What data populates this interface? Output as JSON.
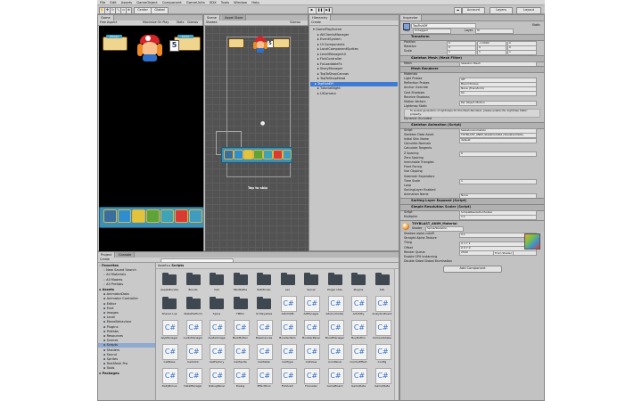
{
  "menubar": {
    "items": [
      "File",
      "Edit",
      "Assets",
      "GameObject",
      "Component",
      "GameUnits",
      "SDX",
      "Tools",
      "Window",
      "Help"
    ]
  },
  "toolbar": {
    "pivot": "Center",
    "space": "Global",
    "account": "Account",
    "layers": "Layers",
    "layout": "Layout"
  },
  "game_view": {
    "tab": "Game",
    "aspect": "Free Aspect",
    "scale_label": "Maximize On Play",
    "stats": "Stats",
    "gizmos": "Gizmos",
    "hud": {
      "left_label": "Moves",
      "right_label": "Score",
      "counter": "5"
    }
  },
  "scene_view": {
    "tabs": [
      "Scene",
      "Asset Store"
    ],
    "mode": "Shaded",
    "gizmos": "Gizmos",
    "tap_label": "Tap to skip",
    "counter": "5"
  },
  "hierarchy": {
    "tab": "Hierarchy",
    "create": "Create",
    "items": [
      {
        "label": "GamePlayScene",
        "selected": false,
        "indent": 0
      },
      {
        "label": "AllClientsManager",
        "selected": false,
        "indent": 1
      },
      {
        "label": "EventSystem",
        "selected": false,
        "indent": 1
      },
      {
        "label": "UI Components",
        "selected": false,
        "indent": 1
      },
      {
        "label": "LocalComponentSprites",
        "selected": false,
        "indent": 1
      },
      {
        "label": "LevelManagerUI",
        "selected": false,
        "indent": 1
      },
      {
        "label": "FishController",
        "selected": false,
        "indent": 1
      },
      {
        "label": "FxLoadableFx",
        "selected": false,
        "indent": 1
      },
      {
        "label": "StoryManager",
        "selected": false,
        "indent": 1
      },
      {
        "label": "TopToShopCanvas",
        "selected": false,
        "indent": 1
      },
      {
        "label": "TapToShopHead",
        "selected": false,
        "indent": 1
      },
      {
        "label": "TapFishEff",
        "selected": true,
        "indent": 1
      },
      {
        "label": "TutorialNight",
        "selected": false,
        "indent": 1
      },
      {
        "label": "UICamera",
        "selected": false,
        "indent": 1
      }
    ]
  },
  "inspector": {
    "tab": "Inspector",
    "object_name": "TapFishEff",
    "static": "Static",
    "tag_label": "Tag",
    "tag": "Untagged",
    "layer_label": "Layer",
    "layer": "UI",
    "transform": {
      "title": "Transform",
      "position": "Position",
      "rotation": "Rotation",
      "scale": "Scale",
      "px": "0",
      "py": "-1.0000",
      "pz": "0",
      "rx": "0",
      "ry": "0",
      "rz": "0",
      "sx": "1",
      "sy": "1",
      "sz": "1"
    },
    "mesh_filter": {
      "title": "Skeleton Mesh (Mesh Filter)",
      "mesh_label": "Mesh",
      "mesh": "Skeleton Mesh"
    },
    "mesh_renderer": {
      "title": "Mesh Renderer",
      "rows": [
        {
          "label": "Materials",
          "value": ""
        },
        {
          "label": "Light Probes",
          "value": "Off"
        },
        {
          "label": "Reflection Probes",
          "value": "Blend Probes"
        },
        {
          "label": "Anchor Override",
          "value": "None (Transform)"
        },
        {
          "label": "Cast Shadows",
          "value": "On"
        },
        {
          "label": "Receive Shadows",
          "value": ""
        },
        {
          "label": "Motion Vectors",
          "value": "Per Object Motion"
        },
        {
          "label": "Lightmap Static",
          "value": ""
        }
      ],
      "note": "To enable generation of lightmaps for this Mesh Renderer, please enable the 'Lightmap Static' property.",
      "dynamic_occluded": "Dynamic Occluded"
    },
    "skeleton_animation": {
      "title": "Skeleton Animation (Script)",
      "rows": [
        {
          "label": "Script",
          "value": "SkeletonAnimation"
        },
        {
          "label": "Skeleton Data Asset",
          "value": "TOYBLAST_ANIM_SkeletonData (SkeletonData)"
        },
        {
          "label": "Initial Skin Name",
          "value": "default"
        },
        {
          "label": "Calculate Normals",
          "value": ""
        },
        {
          "label": "Calculate Tangents",
          "value": ""
        },
        {
          "label": "Z Spacing",
          "value": "0"
        },
        {
          "label": "Zero Spacing",
          "value": ""
        },
        {
          "label": "Immutable Triangles",
          "value": ""
        },
        {
          "label": "Front Facing",
          "value": ""
        },
        {
          "label": "Use Clipping",
          "value": ""
        },
        {
          "label": "Submesh Separators",
          "value": ""
        },
        {
          "label": "Time Scale",
          "value": "1"
        },
        {
          "label": "Loop",
          "value": ""
        },
        {
          "label": "SortingLayer Enabled",
          "value": ""
        },
        {
          "label": "Animation Name",
          "value": "None"
        }
      ]
    },
    "sorting_layer": {
      "title": "Sorting Layer Exposed (Script)"
    },
    "simple_scale": {
      "title": "Simple Resolution Scaler (Script)",
      "script_label": "Script",
      "script": "SimpleResolutionScaler",
      "multiplier_label": "Multiplier",
      "multiplier": "1.1"
    },
    "material": {
      "name": "TOYBLAST_ANIM_Material",
      "shader_label": "Shader",
      "shader": "Spine/Skeleton",
      "rows": [
        {
          "label": "Shadow alpha cutoff",
          "value": "0.1"
        },
        {
          "label": "Straight Alpha Texture",
          "value": ""
        },
        {
          "label": "Tiling",
          "value": "X 1   Y 1"
        },
        {
          "label": "Offset",
          "value": "X 0   Y 0"
        },
        {
          "label": "Render Queue",
          "value": "2500"
        },
        {
          "label": "Enable GPU Instancing",
          "value": ""
        },
        {
          "label": "Double Sided Global Illumination",
          "value": ""
        }
      ],
      "from_shader": "From Shader"
    },
    "add_component": "Add Component"
  },
  "project": {
    "tabs": [
      "Project",
      "Console"
    ],
    "create": "Create",
    "favorites": {
      "title": "Favorites",
      "items": [
        "New Saved Search",
        "All Materials",
        "All Models",
        "All Prefabs"
      ]
    },
    "assets_tree": {
      "title": "Assets",
      "items": [
        "AnimatorData",
        "Animator Controller",
        "Editor",
        "Font",
        "Images",
        "Level",
        "MonoBehaviour",
        "Plugins",
        "Prefabs",
        "Resources",
        "Scenes",
        "Scripts",
        "Shaders",
        "Sound",
        "Sprites",
        "TextMesh Pro",
        "Tools"
      ]
    },
    "packages": "Packages",
    "breadcrumb": [
      "Assets",
      "Scripts"
    ],
    "assets": [
      {
        "name": "AssetsBundle",
        "type": "folder"
      },
      {
        "name": "Boosts",
        "type": "folder"
      },
      {
        "name": "Cell",
        "type": "folder"
      },
      {
        "name": "MiniBattle",
        "type": "folder"
      },
      {
        "name": "Pathfinder",
        "type": "folder"
      },
      {
        "name": "Lev",
        "type": "folder"
      },
      {
        "name": "Server",
        "type": "folder"
      },
      {
        "name": "Plugin Utils",
        "type": "folder"
      },
      {
        "name": "Plugins",
        "type": "folder"
      },
      {
        "name": "Sdk",
        "type": "folder"
      },
      {
        "name": "Shared Lua",
        "type": "folder"
      },
      {
        "name": "StatePlatform",
        "type": "folder"
      },
      {
        "name": "Spine",
        "type": "folder"
      },
      {
        "name": "TMPro",
        "type": "folder"
      },
      {
        "name": "UI Playables",
        "type": "folder"
      },
      {
        "name": "AdInfoDB",
        "type": "cs"
      },
      {
        "name": "AdManager",
        "type": "cs"
      },
      {
        "name": "AdsController",
        "type": "cs"
      },
      {
        "name": "AdUtility",
        "type": "cs"
      },
      {
        "name": "AnalyticsEvent",
        "type": "cs"
      },
      {
        "name": "AppManager",
        "type": "cs"
      },
      {
        "name": "AudioManager",
        "type": "cs"
      },
      {
        "name": "AvatarImage",
        "type": "cs"
      },
      {
        "name": "BackButton",
        "type": "cs"
      },
      {
        "name": "BaseCanvas",
        "type": "cs"
      },
      {
        "name": "BoosterItem",
        "type": "cs"
      },
      {
        "name": "BoosterPanel",
        "type": "cs"
      },
      {
        "name": "BoostManager",
        "type": "cs"
      },
      {
        "name": "BuyButton",
        "type": "cs"
      },
      {
        "name": "CameraShake",
        "type": "cs"
      },
      {
        "name": "CellBase",
        "type": "cs"
      },
      {
        "name": "CellClick",
        "type": "cs"
      },
      {
        "name": "CellFactory",
        "type": "cs"
      },
      {
        "name": "CellSprite",
        "type": "cs"
      },
      {
        "name": "CellState",
        "type": "cs"
      },
      {
        "name": "CellType",
        "type": "cs"
      },
      {
        "name": "CellView",
        "type": "cs"
      },
      {
        "name": "CoinPanel",
        "type": "cs"
      },
      {
        "name": "ComboEffect",
        "type": "cs"
      },
      {
        "name": "Config",
        "type": "cs"
      },
      {
        "name": "DailyBonus",
        "type": "cs"
      },
      {
        "name": "DataManager",
        "type": "cs"
      },
      {
        "name": "DebugPanel",
        "type": "cs"
      },
      {
        "name": "Dialog",
        "type": "cs"
      },
      {
        "name": "EffectPool",
        "type": "cs"
      },
      {
        "name": "FishAnim",
        "type": "cs"
      },
      {
        "name": "FxLoader",
        "type": "cs"
      },
      {
        "name": "GameBoard",
        "type": "cs"
      },
      {
        "name": "GameData",
        "type": "cs"
      },
      {
        "name": "GameState",
        "type": "cs"
      }
    ]
  },
  "colors": {
    "accent": "#3e7bd6",
    "panel": "#c2c2c2",
    "hud_bar": "#3b8fb4",
    "hud_badge": "#efd58e"
  }
}
